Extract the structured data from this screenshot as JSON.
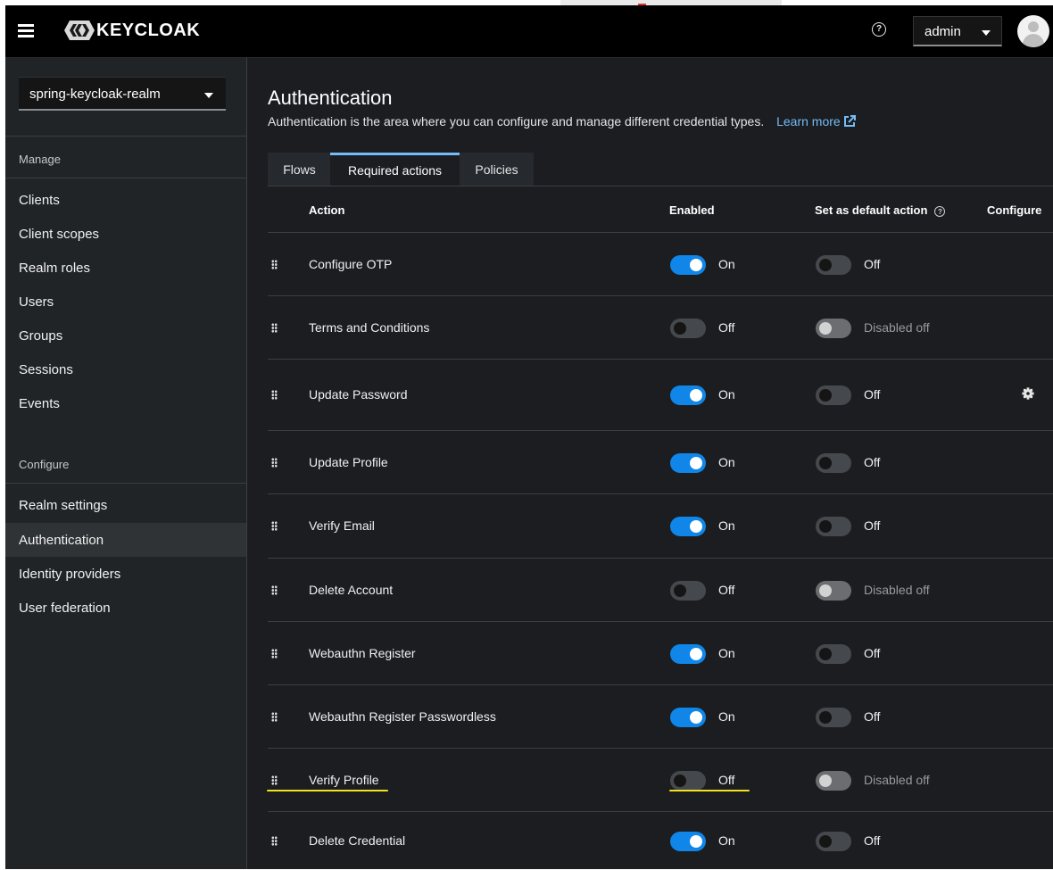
{
  "header": {
    "brand": "KEYCLOAK",
    "help_icon": "?",
    "user": "admin"
  },
  "sidebar": {
    "realm": "spring-keycloak-realm",
    "manage_label": "Manage",
    "configure_label": "Configure",
    "manage_items": [
      {
        "label": "Clients"
      },
      {
        "label": "Client scopes"
      },
      {
        "label": "Realm roles"
      },
      {
        "label": "Users"
      },
      {
        "label": "Groups"
      },
      {
        "label": "Sessions"
      },
      {
        "label": "Events"
      }
    ],
    "configure_items": [
      {
        "label": "Realm settings"
      },
      {
        "label": "Authentication",
        "active": true
      },
      {
        "label": "Identity providers"
      },
      {
        "label": "User federation"
      }
    ]
  },
  "main": {
    "title": "Authentication",
    "description": "Authentication is the area where you can configure and manage different credential types.",
    "learn_more": "Learn more",
    "tabs": [
      {
        "label": "Flows"
      },
      {
        "label": "Required actions",
        "active": true
      },
      {
        "label": "Policies"
      }
    ],
    "table": {
      "headers": {
        "action": "Action",
        "enabled": "Enabled",
        "default": "Set as default action",
        "default_help": "?",
        "configure": "Configure"
      },
      "rows": [
        {
          "name": "Configure OTP",
          "enabled": "On",
          "default": "Off",
          "enabled_state": "on",
          "default_state": "off",
          "configurable": false
        },
        {
          "name": "Terms and Conditions",
          "enabled": "Off",
          "default": "Disabled off",
          "enabled_state": "off",
          "default_state": "disabled",
          "configurable": false
        },
        {
          "name": "Update Password",
          "enabled": "On",
          "default": "Off",
          "enabled_state": "on",
          "default_state": "off",
          "configurable": true
        },
        {
          "name": "Update Profile",
          "enabled": "On",
          "default": "Off",
          "enabled_state": "on",
          "default_state": "off",
          "configurable": false
        },
        {
          "name": "Verify Email",
          "enabled": "On",
          "default": "Off",
          "enabled_state": "on",
          "default_state": "off",
          "configurable": false
        },
        {
          "name": "Delete Account",
          "enabled": "Off",
          "default": "Disabled off",
          "enabled_state": "off",
          "default_state": "disabled",
          "configurable": false
        },
        {
          "name": "Webauthn Register",
          "enabled": "On",
          "default": "Off",
          "enabled_state": "on",
          "default_state": "off",
          "configurable": false
        },
        {
          "name": "Webauthn Register Passwordless",
          "enabled": "On",
          "default": "Off",
          "enabled_state": "on",
          "default_state": "off",
          "configurable": false
        },
        {
          "name": "Verify Profile",
          "enabled": "Off",
          "default": "Disabled off",
          "enabled_state": "off",
          "default_state": "disabled",
          "configurable": false
        },
        {
          "name": "Delete Credential",
          "enabled": "On",
          "default": "Off",
          "enabled_state": "on",
          "default_state": "off",
          "configurable": false
        }
      ]
    }
  },
  "colors": {
    "toggle_on": "#0f86e8",
    "link": "#73bcf7",
    "annotation": "#f3e21d"
  }
}
